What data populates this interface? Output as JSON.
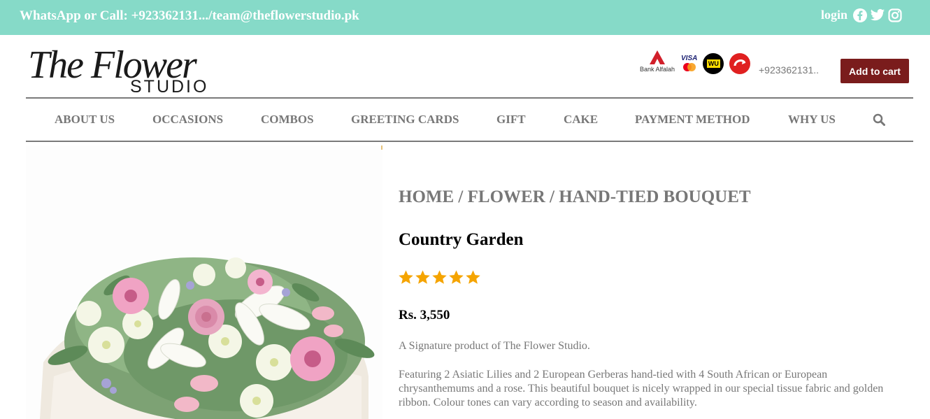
{
  "topbar": {
    "contact": "WhatsApp or Call: +923362131.../team@theflowerstudio.pk",
    "login": "login",
    "social_icons": [
      "facebook-icon",
      "twitter-icon",
      "instagram-icon"
    ]
  },
  "header": {
    "logo_script": "The Flower",
    "logo_sub": "STUDIO",
    "payments": {
      "bank_label": "Bank Alfalah",
      "card_label": "VISA",
      "wu_label": "WU"
    },
    "phone": "+923362131..",
    "cart_button": "Add to cart"
  },
  "nav": {
    "items": [
      "ABOUT US",
      "OCCASIONS",
      "COMBOS",
      "GREETING CARDS",
      "GIFT",
      "CAKE",
      "PAYMENT METHOD",
      "WHY US"
    ],
    "search_icon": "search-icon"
  },
  "product": {
    "breadcrumb": [
      "HOME",
      "FLOWER",
      "HAND-TIED BOUQUET"
    ],
    "breadcrumb_sep": " / ",
    "title": "Country Garden",
    "rating": 5,
    "rating_max": 5,
    "price": "Rs. 3,550",
    "description_short": "A Signature product of The Flower Studio.",
    "description_long": "Featuring 2 Asiatic Lilies and 2 European Gerberas hand-tied with 4 South African or European chrysanthemums and a rose. This beautiful bouquet is nicely wrapped in our special tissue fabric and golden ribbon. Colour tones can vary according to season and availability."
  },
  "colors": {
    "topbar": "#86dac8",
    "cart_button": "#7a1c1c",
    "nav_text": "#777777",
    "star": "#f5a400"
  }
}
